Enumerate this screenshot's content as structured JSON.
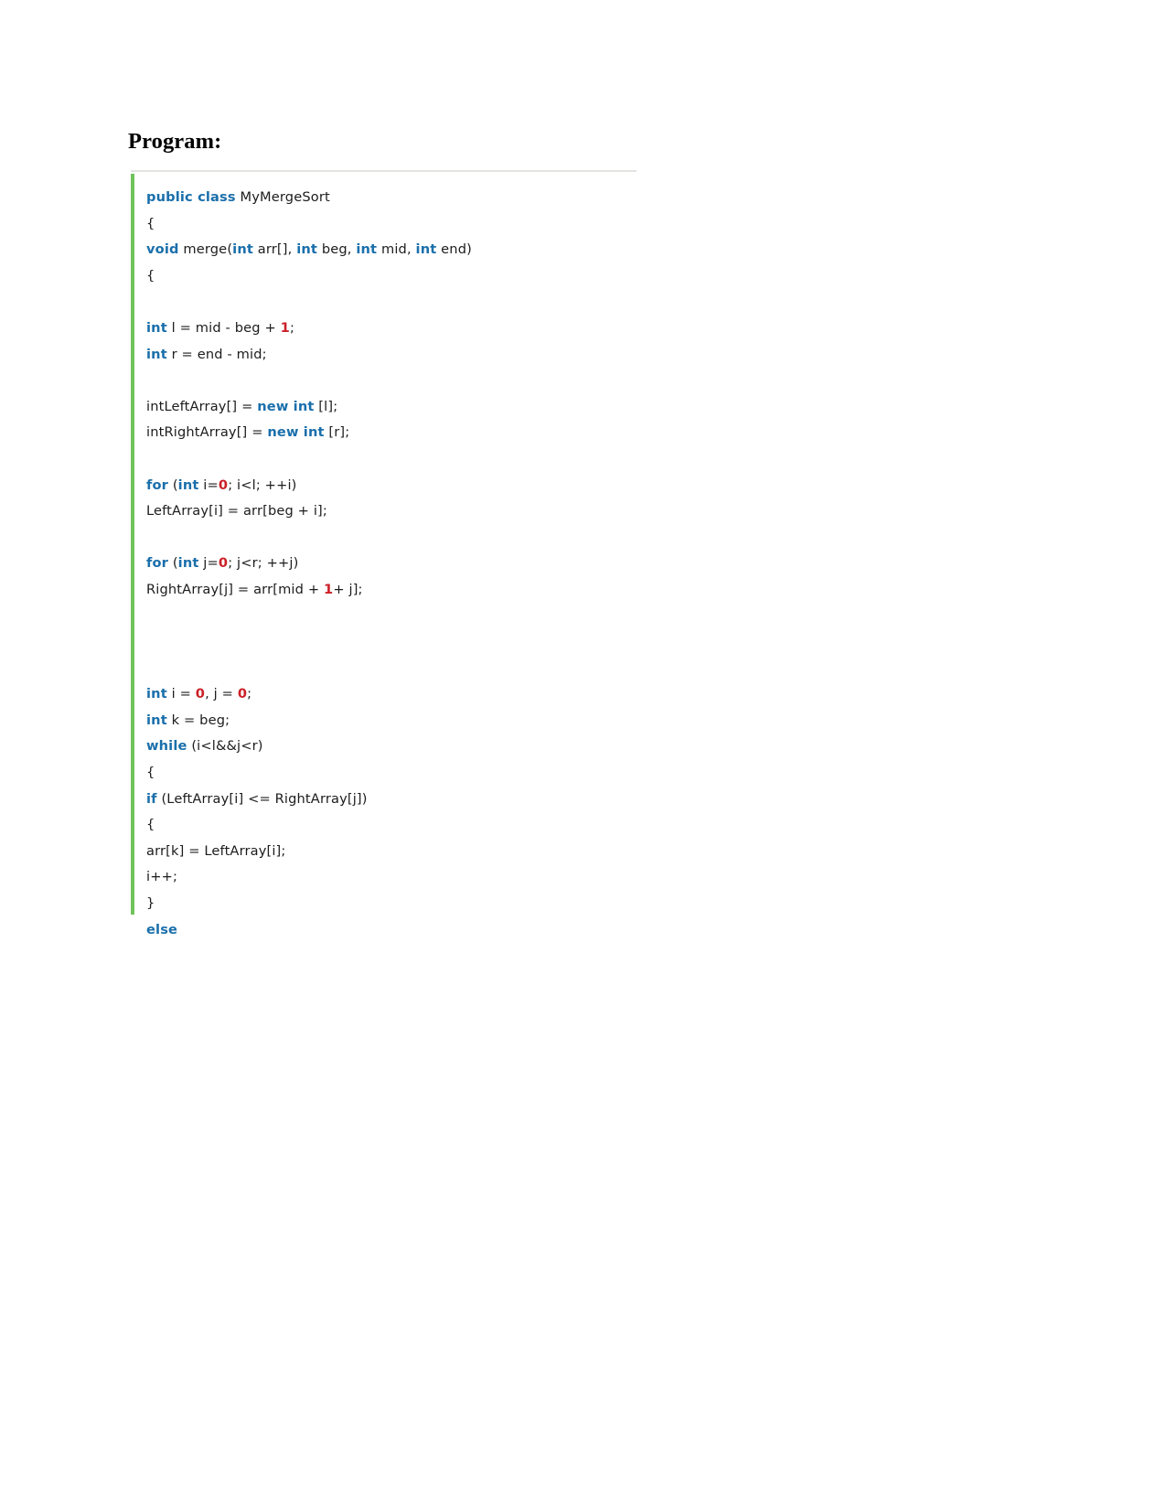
{
  "document": {
    "heading": "Program:",
    "language": "java",
    "colors": {
      "keyword": "#1a6fab",
      "number": "#cb2027",
      "plain": "#1c1c1c",
      "gutter_accent": "#6fc35a",
      "top_rule": "#e3e3e0",
      "background": "#ffffff"
    }
  },
  "code": {
    "lines": [
      {
        "id": 1,
        "text": "public class MyMergeSort",
        "tokens": [
          {
            "t": "public class",
            "k": "kw"
          },
          {
            "t": " MyMergeSort",
            "k": "plain"
          }
        ]
      },
      {
        "id": 2,
        "text": "{",
        "tokens": [
          {
            "t": "{",
            "k": "plain"
          }
        ]
      },
      {
        "id": 3,
        "text": "void merge(int arr[], int beg, int mid, int end)",
        "tokens": [
          {
            "t": "void",
            "k": "kw"
          },
          {
            "t": " merge(",
            "k": "plain"
          },
          {
            "t": "int",
            "k": "kw"
          },
          {
            "t": " arr[], ",
            "k": "plain"
          },
          {
            "t": "int",
            "k": "kw"
          },
          {
            "t": " beg, ",
            "k": "plain"
          },
          {
            "t": "int",
            "k": "kw"
          },
          {
            "t": " mid, ",
            "k": "plain"
          },
          {
            "t": "int",
            "k": "kw"
          },
          {
            "t": " end)",
            "k": "plain"
          }
        ]
      },
      {
        "id": 4,
        "text": "{",
        "tokens": [
          {
            "t": "{",
            "k": "plain"
          }
        ]
      },
      {
        "id": 5,
        "text": "",
        "tokens": []
      },
      {
        "id": 6,
        "text": "int l = mid - beg + 1;",
        "tokens": [
          {
            "t": "int",
            "k": "kw"
          },
          {
            "t": " l = mid - beg + ",
            "k": "plain"
          },
          {
            "t": "1",
            "k": "num"
          },
          {
            "t": ";",
            "k": "plain"
          }
        ]
      },
      {
        "id": 7,
        "text": "int r = end - mid;",
        "tokens": [
          {
            "t": "int",
            "k": "kw"
          },
          {
            "t": " r = end - mid;",
            "k": "plain"
          }
        ]
      },
      {
        "id": 8,
        "text": "",
        "tokens": []
      },
      {
        "id": 9,
        "text": "intLeftArray[] = new int [l];",
        "tokens": [
          {
            "t": "intLeftArray[] = ",
            "k": "plain"
          },
          {
            "t": "new int",
            "k": "kw"
          },
          {
            "t": " [l];",
            "k": "plain"
          }
        ]
      },
      {
        "id": 10,
        "text": "intRightArray[] = new int [r];",
        "tokens": [
          {
            "t": "intRightArray[] = ",
            "k": "plain"
          },
          {
            "t": "new int",
            "k": "kw"
          },
          {
            "t": " [r];",
            "k": "plain"
          }
        ]
      },
      {
        "id": 11,
        "text": "",
        "tokens": []
      },
      {
        "id": 12,
        "text": "for (int i=0; i<l; ++i)",
        "tokens": [
          {
            "t": "for",
            "k": "kw"
          },
          {
            "t": " (",
            "k": "plain"
          },
          {
            "t": "int",
            "k": "kw"
          },
          {
            "t": " i=",
            "k": "plain"
          },
          {
            "t": "0",
            "k": "num"
          },
          {
            "t": "; i<l; ++i)",
            "k": "plain"
          }
        ]
      },
      {
        "id": 13,
        "text": "LeftArray[i] = arr[beg + i];",
        "tokens": [
          {
            "t": "LeftArray[i] = arr[beg + i];",
            "k": "plain"
          }
        ]
      },
      {
        "id": 14,
        "text": "",
        "tokens": []
      },
      {
        "id": 15,
        "text": "for (int j=0; j<r; ++j)",
        "tokens": [
          {
            "t": "for",
            "k": "kw"
          },
          {
            "t": " (",
            "k": "plain"
          },
          {
            "t": "int",
            "k": "kw"
          },
          {
            "t": " j=",
            "k": "plain"
          },
          {
            "t": "0",
            "k": "num"
          },
          {
            "t": "; j<r; ++j)",
            "k": "plain"
          }
        ]
      },
      {
        "id": 16,
        "text": "RightArray[j] = arr[mid + 1+ j];",
        "tokens": [
          {
            "t": "RightArray[j] = arr[mid + ",
            "k": "plain"
          },
          {
            "t": "1",
            "k": "num"
          },
          {
            "t": "+ j];",
            "k": "plain"
          }
        ]
      },
      {
        "id": 17,
        "text": "",
        "tokens": []
      },
      {
        "id": 18,
        "text": "",
        "tokens": []
      },
      {
        "id": 19,
        "text": "",
        "tokens": []
      },
      {
        "id": 20,
        "text": "int i = 0, j = 0;",
        "tokens": [
          {
            "t": "int",
            "k": "kw"
          },
          {
            "t": " i = ",
            "k": "plain"
          },
          {
            "t": "0",
            "k": "num"
          },
          {
            "t": ", j = ",
            "k": "plain"
          },
          {
            "t": "0",
            "k": "num"
          },
          {
            "t": ";",
            "k": "plain"
          }
        ]
      },
      {
        "id": 21,
        "text": "int k = beg;",
        "tokens": [
          {
            "t": "int",
            "k": "kw"
          },
          {
            "t": " k = beg;",
            "k": "plain"
          }
        ]
      },
      {
        "id": 22,
        "text": "while (i<l&&j<r)",
        "tokens": [
          {
            "t": "while",
            "k": "kw"
          },
          {
            "t": " (i<l&&j<r)",
            "k": "plain"
          }
        ]
      },
      {
        "id": 23,
        "text": "{",
        "tokens": [
          {
            "t": "{",
            "k": "plain"
          }
        ]
      },
      {
        "id": 24,
        "text": "if (LeftArray[i] <= RightArray[j])",
        "tokens": [
          {
            "t": "if",
            "k": "kw"
          },
          {
            "t": " (LeftArray[i] <= RightArray[j])",
            "k": "plain"
          }
        ]
      },
      {
        "id": 25,
        "text": "{",
        "tokens": [
          {
            "t": "{",
            "k": "plain"
          }
        ]
      },
      {
        "id": 26,
        "text": "arr[k] = LeftArray[i];",
        "tokens": [
          {
            "t": "arr[k] = LeftArray[i];",
            "k": "plain"
          }
        ]
      },
      {
        "id": 27,
        "text": "i++;",
        "tokens": [
          {
            "t": "i++;",
            "k": "plain"
          }
        ]
      },
      {
        "id": 28,
        "text": "}",
        "tokens": [
          {
            "t": "}",
            "k": "plain"
          }
        ]
      },
      {
        "id": 29,
        "text": "else",
        "tokens": [
          {
            "t": "else",
            "k": "kw"
          }
        ]
      }
    ]
  }
}
